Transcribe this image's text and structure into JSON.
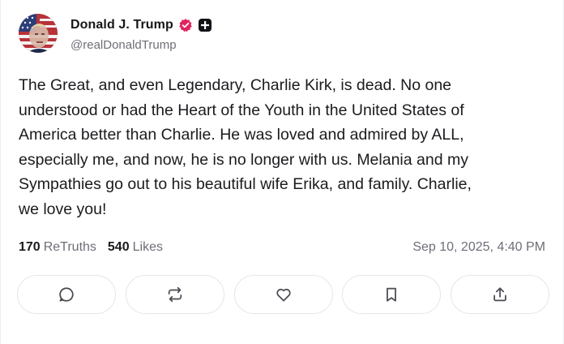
{
  "author": {
    "display_name": "Donald J. Trump",
    "handle": "@realDonaldTrump",
    "verified_icon": "verified-badge-icon",
    "extra_icon": "plus-badge-icon",
    "verified_color": "#e0245e"
  },
  "post": {
    "text": "The Great, and even Legendary, Charlie Kirk, is dead. No one\nunderstood or had the Heart of the Youth in the United States of\nAmerica better than Charlie. He was loved and admired by ALL,\nespecially me, and now, he is no longer with us. Melania and my\nSympathies go out to his beautiful wife Erika, and family. Charlie,\nwe love you!"
  },
  "stats": {
    "retruths_count": "170",
    "retruths_label": "ReTruths",
    "likes_count": "540",
    "likes_label": "Likes",
    "timestamp": "Sep 10, 2025, 4:40 PM"
  },
  "actions": [
    {
      "name": "reply",
      "icon": "comment-icon"
    },
    {
      "name": "retruth",
      "icon": "repost-icon"
    },
    {
      "name": "like",
      "icon": "heart-icon"
    },
    {
      "name": "bookmark",
      "icon": "bookmark-icon"
    },
    {
      "name": "share",
      "icon": "share-icon"
    }
  ]
}
